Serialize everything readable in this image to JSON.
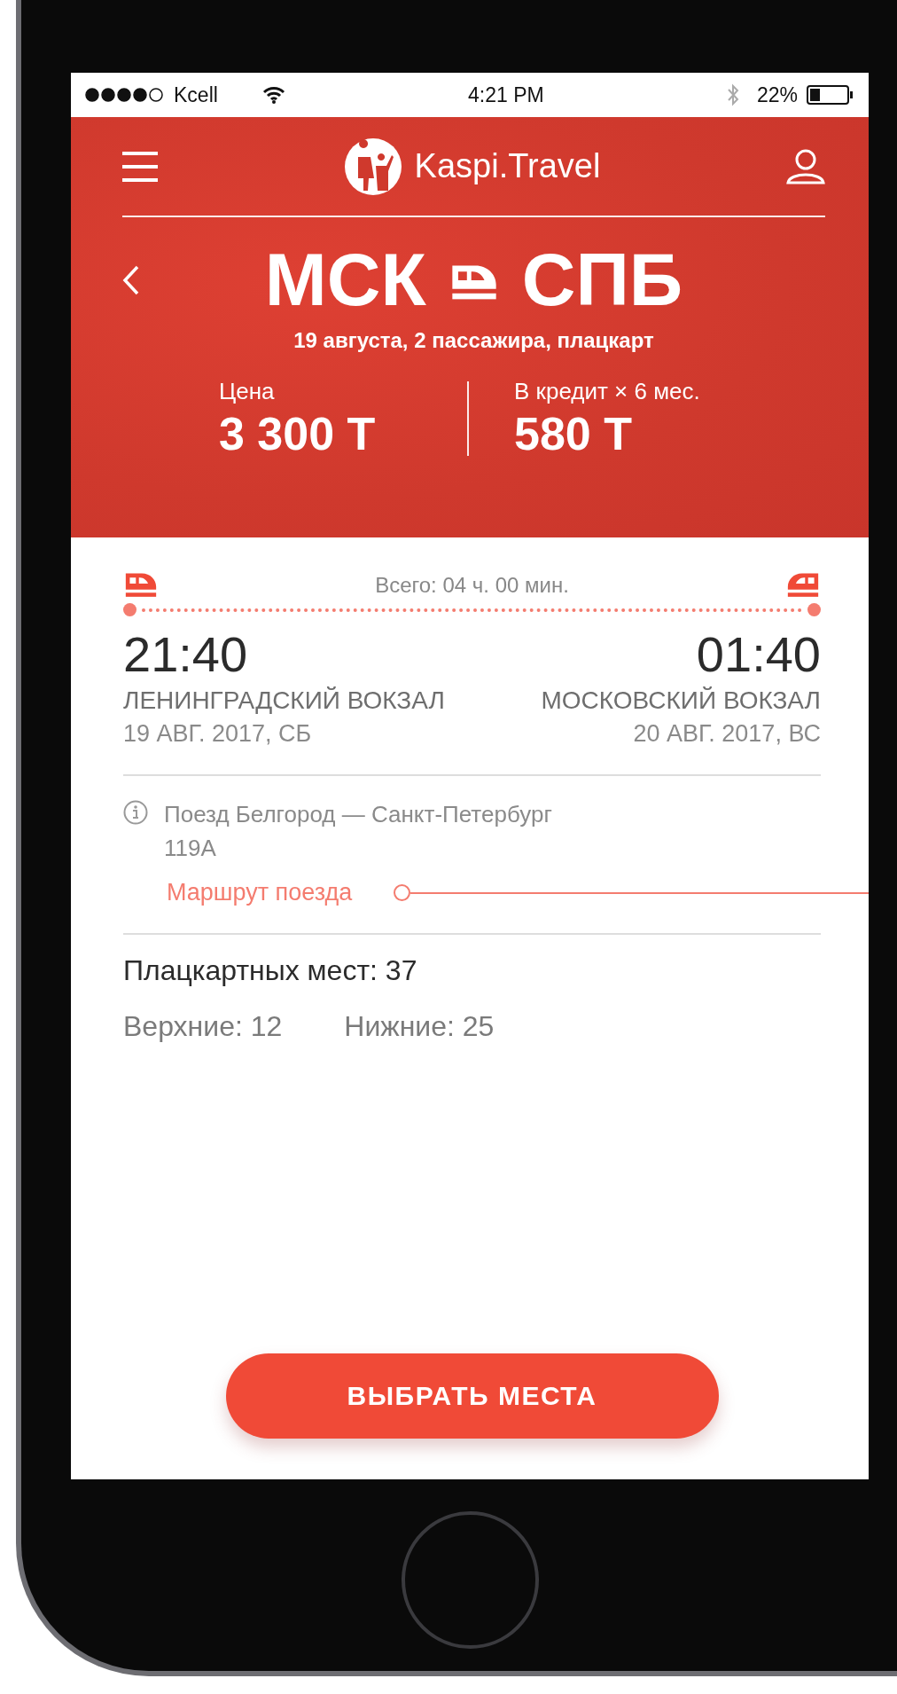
{
  "status_bar": {
    "carrier": "Kcell",
    "time": "4:21 PM",
    "battery": "22%"
  },
  "header": {
    "brand": "Kaspi.Travel",
    "from": "МСК",
    "to": "СПБ",
    "subtitle": "19 августа, 2 пассажира, плацкарт",
    "price": {
      "label": "Цена",
      "value": "3 300 Т"
    },
    "credit": {
      "label": "В кредит × 6 мес.",
      "value": "580 Т"
    }
  },
  "trip": {
    "duration": "Всего: 04 ч. 00 мин.",
    "departure": {
      "time": "21:40",
      "station": "ЛЕНИНГРАДСКИЙ ВОКЗАЛ",
      "date": "19 АВГ. 2017, СБ"
    },
    "arrival": {
      "time": "01:40",
      "station": "МОСКОВСКИЙ ВОКЗАЛ",
      "date": "20 АВГ. 2017, ВС"
    }
  },
  "train": {
    "name": "Поезд Белгород — Санкт-Петербург",
    "number": "119А",
    "route_link": "Маршрут поезда"
  },
  "seats": {
    "total": "Плацкартных мест: 37",
    "upper": "Верхние: 12",
    "lower": "Нижние: 25"
  },
  "button": "ВЫБРАТЬ МЕСТА"
}
